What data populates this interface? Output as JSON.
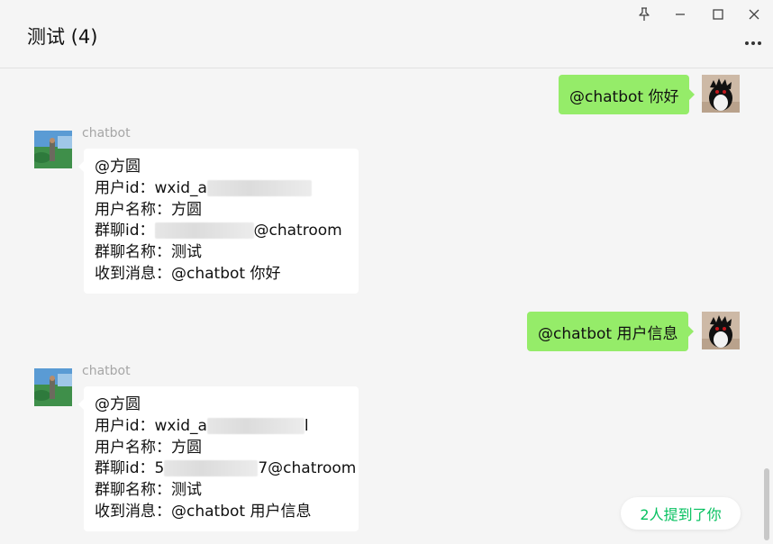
{
  "header": {
    "title": "测试 (4)"
  },
  "window_controls": {
    "pin_icon": "pin-icon",
    "minimize_icon": "minimize-icon",
    "maximize_icon": "maximize-icon",
    "close_icon": "close-icon",
    "more_icon": "more-dots-icon"
  },
  "messages": [
    {
      "direction": "outgoing",
      "text": "@chatbot 你好"
    },
    {
      "direction": "incoming",
      "sender": "chatbot",
      "lines": {
        "mention": "@方圆",
        "userid_prefix": "用户id：wxid_a",
        "username": "用户名称：方圆",
        "groupid_prefix": "群聊id：",
        "groupid_suffix": "@chatroom",
        "groupname": "群聊名称：测试",
        "received": "收到消息：@chatbot 你好"
      }
    },
    {
      "direction": "outgoing",
      "text": "@chatbot 用户信息"
    },
    {
      "direction": "incoming",
      "sender": "chatbot",
      "lines": {
        "mention": "@方圆",
        "userid_prefix": "用户id：wxid_a",
        "userid_suffix": "l",
        "username": "用户名称：方圆",
        "groupid_prefix": "群聊id：5",
        "groupid_suffix": "7@chatroom",
        "groupname": "群聊名称：测试",
        "received": "收到消息：@chatbot 用户信息"
      }
    }
  ],
  "mention_notice": "2人提到了你",
  "colors": {
    "background": "#f5f5f5",
    "outgoing_bubble": "#95ec69",
    "incoming_bubble": "#ffffff",
    "accent_green": "#07c160",
    "sender_name": "#a6a6a6"
  }
}
